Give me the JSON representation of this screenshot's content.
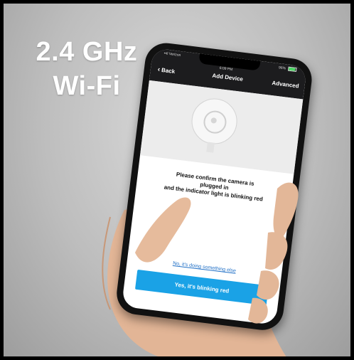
{
  "headline": {
    "line1": "2.4 GHz",
    "line2": "Wi-Fi"
  },
  "status_bar": {
    "carrier": "••ll Verizon",
    "time": "6:09 PM",
    "battery": "96%"
  },
  "nav": {
    "back_label": "Back",
    "title": "Add Device",
    "advanced_label": "Advanced"
  },
  "prompt": {
    "line1": "Please confirm the camera is",
    "line2": "plugged in",
    "line3": "and the indicator light is blinking red"
  },
  "actions": {
    "secondary_link": "No, it's doing something else",
    "primary_button": "Yes, it's blinking red"
  },
  "colors": {
    "accent": "#1aa2e6",
    "link": "#1f6fc6",
    "nav_bg": "#1c1c1e"
  },
  "icons": {
    "back": "chevron-left-icon",
    "camera": "camera-illustration",
    "battery": "battery-icon"
  }
}
